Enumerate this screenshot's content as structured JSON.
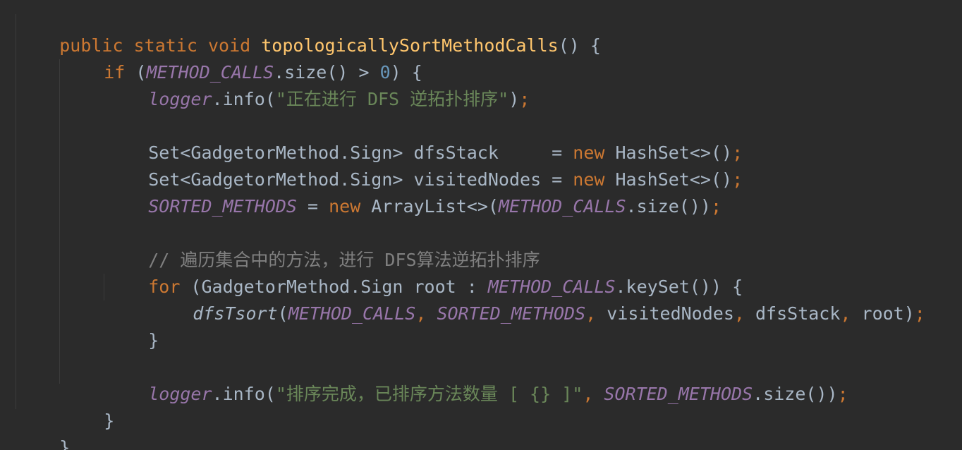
{
  "editor": {
    "colors": {
      "background": "#2b2b2b",
      "keyword": "#cc7832",
      "method_declaration": "#ffc66d",
      "static_field": "#9876aa",
      "number": "#6897bb",
      "string": "#6a8759",
      "comment": "#808080",
      "default_text": "#a9b7c6"
    },
    "lines": {
      "l1": {
        "kw_public": "public",
        "kw_static": "static",
        "kw_void": "void",
        "method_name": "topologicallySortMethodCalls",
        "tail": "() {"
      },
      "l2": {
        "kw_if": "if",
        "open": " (",
        "const": "METHOD_CALLS",
        "call": ".size() > ",
        "num": "0",
        "tail": ") {"
      },
      "l3": {
        "logger": "logger",
        "call": ".info(",
        "str": "\"正在进行 DFS 逆拓扑排序\"",
        "close": ")",
        "semi": ";"
      },
      "l5": {
        "text": "Set<GadgetorMethod.Sign> dfsStack     = ",
        "kw_new": "new",
        "rest": " HashSet<>()",
        "semi": ";"
      },
      "l6": {
        "text": "Set<GadgetorMethod.Sign> visitedNodes = ",
        "kw_new": "new",
        "rest": " HashSet<>()",
        "semi": ";"
      },
      "l7": {
        "const1": "SORTED_METHODS",
        "eq": " = ",
        "kw_new": "new",
        "rest": " ArrayList<>(",
        "const2": "METHOD_CALLS",
        "call": ".size())",
        "semi": ";"
      },
      "l9": {
        "comment": "// 遍历集合中的方法，进行 DFS算法逆拓扑排序"
      },
      "l10": {
        "kw_for": "for",
        "text": " (GadgetorMethod.Sign root : ",
        "const": "METHOD_CALLS",
        "tail": ".keySet()) {"
      },
      "l11": {
        "fn": "dfsTsort",
        "open": "(",
        "const1": "METHOD_CALLS",
        "comma1": ", ",
        "const2": "SORTED_METHODS",
        "comma2": ", ",
        "arg3": "visitedNodes",
        "comma3": ", ",
        "arg4": "dfsStack",
        "comma4": ", ",
        "arg5": "root)",
        "semi": ";"
      },
      "l12": {
        "brace": "}"
      },
      "l14": {
        "logger": "logger",
        "call": ".info(",
        "str": "\"排序完成，已排序方法数量 [ {} ]\"",
        "comma": ", ",
        "const": "SORTED_METHODS",
        "call2": ".size())",
        "semi": ";"
      },
      "l15": {
        "brace": "}"
      },
      "l16": {
        "brace": "}"
      }
    }
  }
}
